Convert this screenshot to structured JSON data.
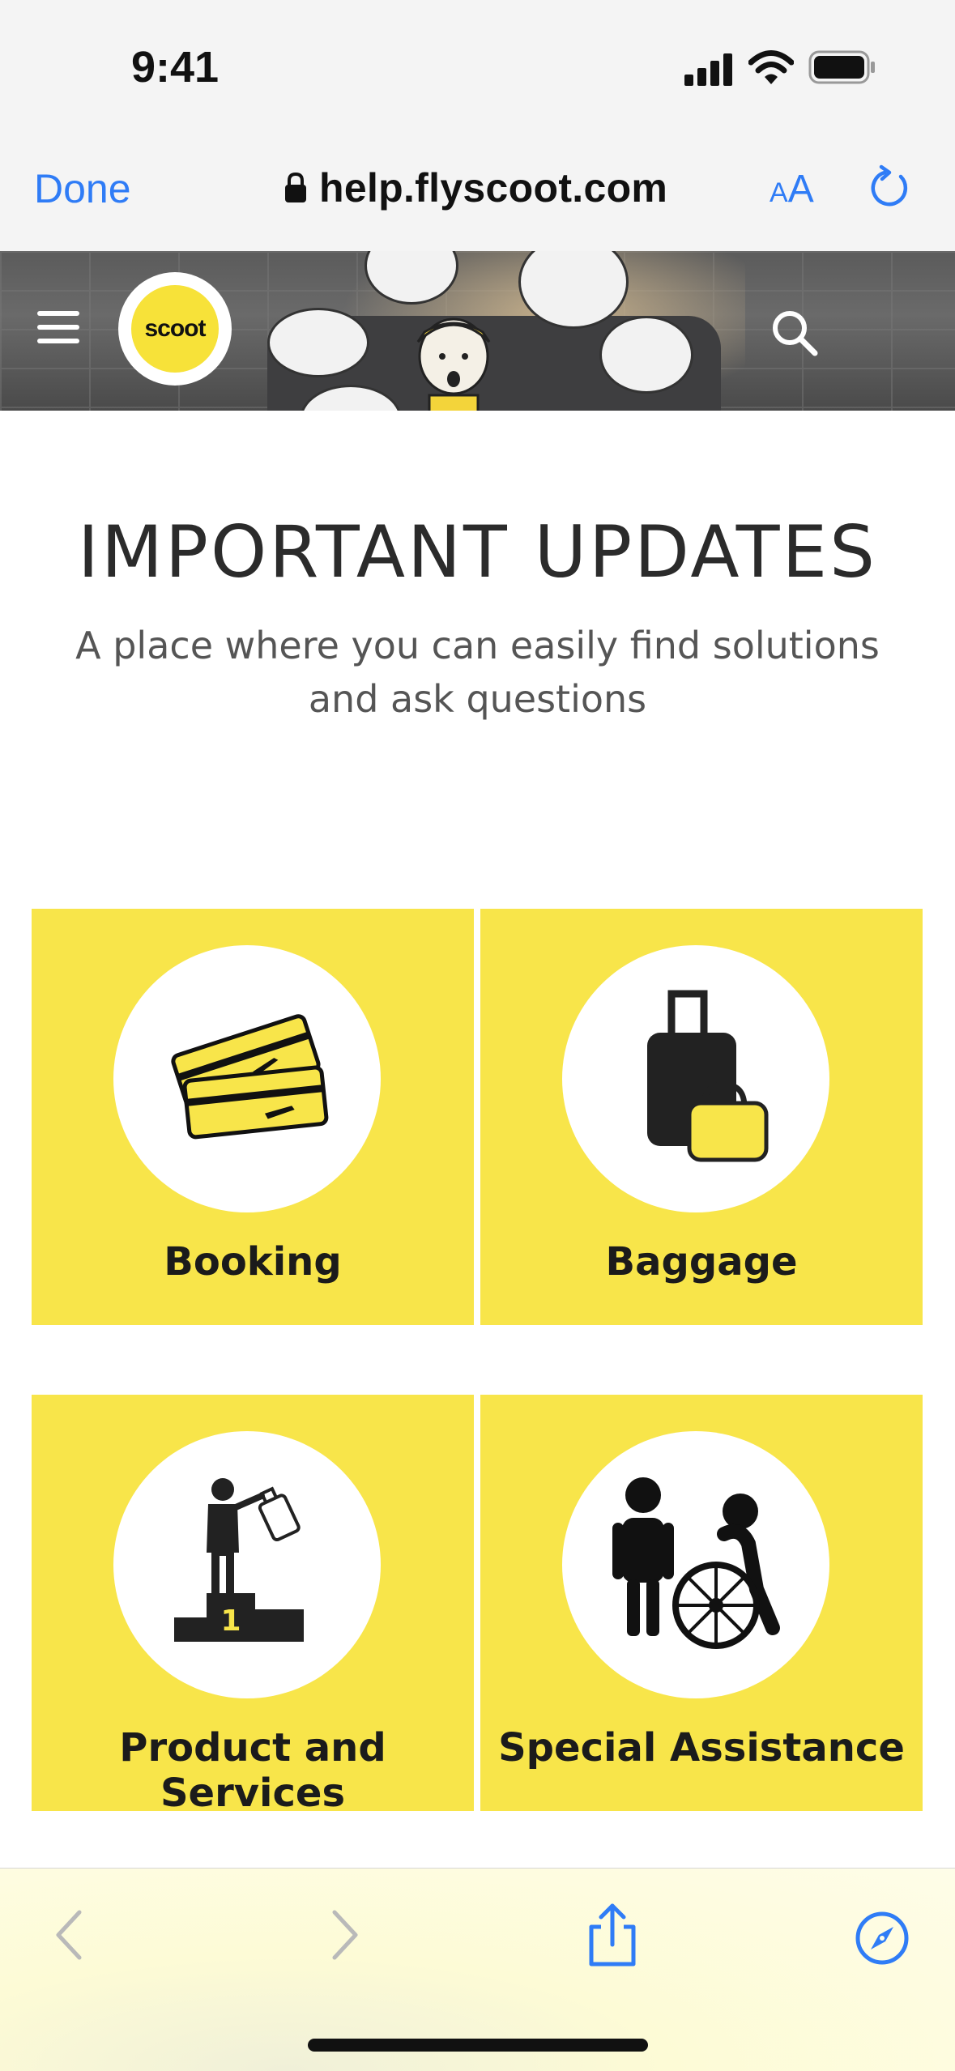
{
  "status_bar": {
    "time": "9:41"
  },
  "browser": {
    "done_label": "Done",
    "url": "help.flyscoot.com",
    "text_size_small": "A",
    "text_size_large": "A"
  },
  "header": {
    "logo_text": "scoot"
  },
  "hero": {
    "title": "IMPORTANT UPDATES",
    "subtitle": "A place where you can easily find solutions and ask questions"
  },
  "categories": [
    {
      "label": "Booking",
      "icon": "boarding-pass-icon"
    },
    {
      "label": "Baggage",
      "icon": "luggage-icon"
    },
    {
      "label": "Product and Services",
      "icon": "podium-icon"
    },
    {
      "label": "Special Assistance",
      "icon": "wheelchair-icon"
    }
  ],
  "colors": {
    "accent": "#2f7cf6",
    "brand_yellow": "#f8e54a",
    "text_dark": "#2b2b2b"
  }
}
